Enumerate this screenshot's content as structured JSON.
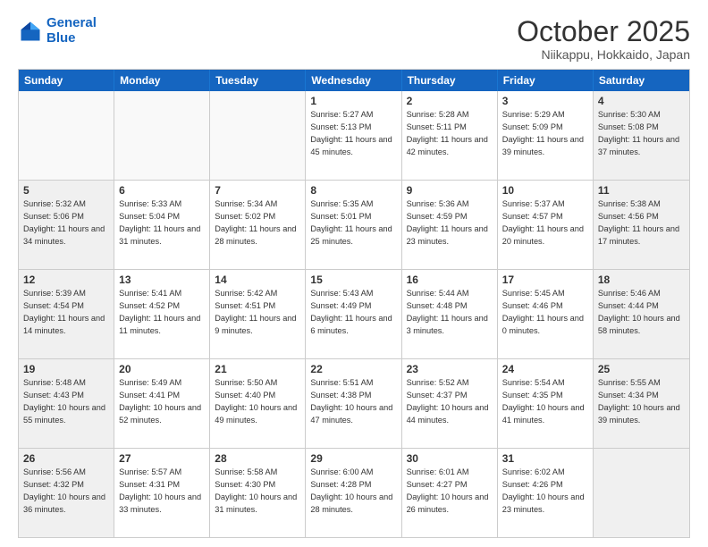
{
  "logo": {
    "line1": "General",
    "line2": "Blue"
  },
  "header": {
    "month": "October 2025",
    "location": "Niikappu, Hokkaido, Japan"
  },
  "weekdays": [
    "Sunday",
    "Monday",
    "Tuesday",
    "Wednesday",
    "Thursday",
    "Friday",
    "Saturday"
  ],
  "rows": [
    [
      {
        "day": "",
        "text": "",
        "empty": true
      },
      {
        "day": "",
        "text": "",
        "empty": true
      },
      {
        "day": "",
        "text": "",
        "empty": true
      },
      {
        "day": "1",
        "text": "Sunrise: 5:27 AM\nSunset: 5:13 PM\nDaylight: 11 hours and 45 minutes.",
        "empty": false
      },
      {
        "day": "2",
        "text": "Sunrise: 5:28 AM\nSunset: 5:11 PM\nDaylight: 11 hours and 42 minutes.",
        "empty": false
      },
      {
        "day": "3",
        "text": "Sunrise: 5:29 AM\nSunset: 5:09 PM\nDaylight: 11 hours and 39 minutes.",
        "empty": false
      },
      {
        "day": "4",
        "text": "Sunrise: 5:30 AM\nSunset: 5:08 PM\nDaylight: 11 hours and 37 minutes.",
        "empty": false,
        "shaded": true
      }
    ],
    [
      {
        "day": "5",
        "text": "Sunrise: 5:32 AM\nSunset: 5:06 PM\nDaylight: 11 hours and 34 minutes.",
        "empty": false,
        "shaded": true
      },
      {
        "day": "6",
        "text": "Sunrise: 5:33 AM\nSunset: 5:04 PM\nDaylight: 11 hours and 31 minutes.",
        "empty": false
      },
      {
        "day": "7",
        "text": "Sunrise: 5:34 AM\nSunset: 5:02 PM\nDaylight: 11 hours and 28 minutes.",
        "empty": false
      },
      {
        "day": "8",
        "text": "Sunrise: 5:35 AM\nSunset: 5:01 PM\nDaylight: 11 hours and 25 minutes.",
        "empty": false
      },
      {
        "day": "9",
        "text": "Sunrise: 5:36 AM\nSunset: 4:59 PM\nDaylight: 11 hours and 23 minutes.",
        "empty": false
      },
      {
        "day": "10",
        "text": "Sunrise: 5:37 AM\nSunset: 4:57 PM\nDaylight: 11 hours and 20 minutes.",
        "empty": false
      },
      {
        "day": "11",
        "text": "Sunrise: 5:38 AM\nSunset: 4:56 PM\nDaylight: 11 hours and 17 minutes.",
        "empty": false,
        "shaded": true
      }
    ],
    [
      {
        "day": "12",
        "text": "Sunrise: 5:39 AM\nSunset: 4:54 PM\nDaylight: 11 hours and 14 minutes.",
        "empty": false,
        "shaded": true
      },
      {
        "day": "13",
        "text": "Sunrise: 5:41 AM\nSunset: 4:52 PM\nDaylight: 11 hours and 11 minutes.",
        "empty": false
      },
      {
        "day": "14",
        "text": "Sunrise: 5:42 AM\nSunset: 4:51 PM\nDaylight: 11 hours and 9 minutes.",
        "empty": false
      },
      {
        "day": "15",
        "text": "Sunrise: 5:43 AM\nSunset: 4:49 PM\nDaylight: 11 hours and 6 minutes.",
        "empty": false
      },
      {
        "day": "16",
        "text": "Sunrise: 5:44 AM\nSunset: 4:48 PM\nDaylight: 11 hours and 3 minutes.",
        "empty": false
      },
      {
        "day": "17",
        "text": "Sunrise: 5:45 AM\nSunset: 4:46 PM\nDaylight: 11 hours and 0 minutes.",
        "empty": false
      },
      {
        "day": "18",
        "text": "Sunrise: 5:46 AM\nSunset: 4:44 PM\nDaylight: 10 hours and 58 minutes.",
        "empty": false,
        "shaded": true
      }
    ],
    [
      {
        "day": "19",
        "text": "Sunrise: 5:48 AM\nSunset: 4:43 PM\nDaylight: 10 hours and 55 minutes.",
        "empty": false,
        "shaded": true
      },
      {
        "day": "20",
        "text": "Sunrise: 5:49 AM\nSunset: 4:41 PM\nDaylight: 10 hours and 52 minutes.",
        "empty": false
      },
      {
        "day": "21",
        "text": "Sunrise: 5:50 AM\nSunset: 4:40 PM\nDaylight: 10 hours and 49 minutes.",
        "empty": false
      },
      {
        "day": "22",
        "text": "Sunrise: 5:51 AM\nSunset: 4:38 PM\nDaylight: 10 hours and 47 minutes.",
        "empty": false
      },
      {
        "day": "23",
        "text": "Sunrise: 5:52 AM\nSunset: 4:37 PM\nDaylight: 10 hours and 44 minutes.",
        "empty": false
      },
      {
        "day": "24",
        "text": "Sunrise: 5:54 AM\nSunset: 4:35 PM\nDaylight: 10 hours and 41 minutes.",
        "empty": false
      },
      {
        "day": "25",
        "text": "Sunrise: 5:55 AM\nSunset: 4:34 PM\nDaylight: 10 hours and 39 minutes.",
        "empty": false,
        "shaded": true
      }
    ],
    [
      {
        "day": "26",
        "text": "Sunrise: 5:56 AM\nSunset: 4:32 PM\nDaylight: 10 hours and 36 minutes.",
        "empty": false,
        "shaded": true
      },
      {
        "day": "27",
        "text": "Sunrise: 5:57 AM\nSunset: 4:31 PM\nDaylight: 10 hours and 33 minutes.",
        "empty": false
      },
      {
        "day": "28",
        "text": "Sunrise: 5:58 AM\nSunset: 4:30 PM\nDaylight: 10 hours and 31 minutes.",
        "empty": false
      },
      {
        "day": "29",
        "text": "Sunrise: 6:00 AM\nSunset: 4:28 PM\nDaylight: 10 hours and 28 minutes.",
        "empty": false
      },
      {
        "day": "30",
        "text": "Sunrise: 6:01 AM\nSunset: 4:27 PM\nDaylight: 10 hours and 26 minutes.",
        "empty": false
      },
      {
        "day": "31",
        "text": "Sunrise: 6:02 AM\nSunset: 4:26 PM\nDaylight: 10 hours and 23 minutes.",
        "empty": false
      },
      {
        "day": "",
        "text": "",
        "empty": true,
        "shaded": true
      }
    ]
  ]
}
